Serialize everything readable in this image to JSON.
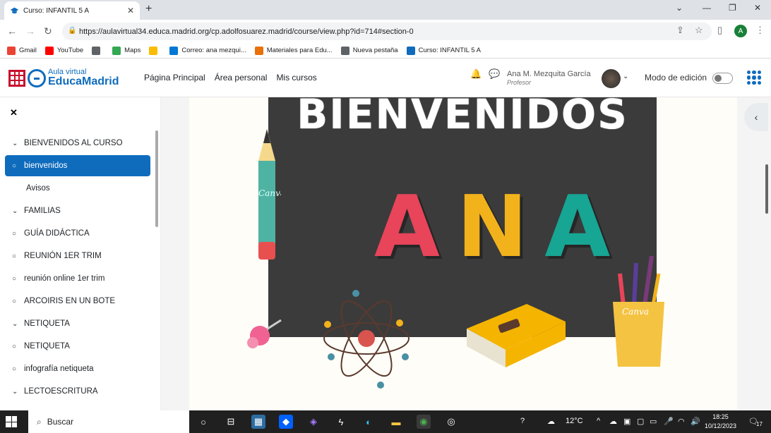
{
  "browser": {
    "tab_title": "Curso: INFANTIL 5 A",
    "url": "https://aulavirtual34.educa.madrid.org/cp.adolfosuarez.madrid/course/view.php?id=714#section-0",
    "profile_initial": "A",
    "bookmarks": [
      {
        "label": "Gmail",
        "color": "#ea4335"
      },
      {
        "label": "YouTube",
        "color": "#ff0000"
      },
      {
        "label": "",
        "color": "#5f6368"
      },
      {
        "label": "Maps",
        "color": "#34a853"
      },
      {
        "label": "",
        "color": "#fbbc04"
      },
      {
        "label": "Correo: ana mezqui...",
        "color": "#0078d4"
      },
      {
        "label": "Materiales para Edu...",
        "color": "#e8710a"
      },
      {
        "label": "Nueva pestaña",
        "color": "#5f6368"
      },
      {
        "label": "Curso: INFANTIL 5 A",
        "color": "#0f6cbd"
      }
    ]
  },
  "site": {
    "logo_line1": "Aula virtual",
    "logo_line2": "EducaMadrid",
    "nav": [
      "Página Principal",
      "Área personal",
      "Mis cursos"
    ],
    "user_name": "Ana M. Mezquita García",
    "user_role": "Profesor",
    "edit_mode_label": "Modo de edición",
    "edit_mode_on": false
  },
  "course_index": [
    {
      "label": "BIENVENIDOS AL CURSO",
      "type": "section"
    },
    {
      "label": "bienvenidos",
      "type": "item",
      "active": true
    },
    {
      "label": "Avisos",
      "type": "plain"
    },
    {
      "label": "FAMILIAS",
      "type": "section"
    },
    {
      "label": "GUÍA DIDÁCTICA",
      "type": "item"
    },
    {
      "label": "REUNIÓN 1ER TRIM",
      "type": "item"
    },
    {
      "label": "reunión online 1er trim",
      "type": "item"
    },
    {
      "label": "ARCOIRIS EN UN BOTE",
      "type": "item"
    },
    {
      "label": "NETIQUETA",
      "type": "section"
    },
    {
      "label": "NETIQUETA",
      "type": "item"
    },
    {
      "label": "infografía netiqueta",
      "type": "item"
    },
    {
      "label": "LECTOESCRITURA",
      "type": "section"
    }
  ],
  "banner": {
    "heading": "BIENVENIDOS",
    "letters": [
      {
        "char": "A",
        "color": "#e8445a"
      },
      {
        "char": "N",
        "color": "#f2b21c"
      },
      {
        "char": "A",
        "color": "#17a594"
      }
    ],
    "watermark": "Canva"
  },
  "taskbar": {
    "search_placeholder": "Buscar",
    "weather": "12°C",
    "time": "18:25",
    "date": "10/12/2023",
    "notifications": "17"
  }
}
